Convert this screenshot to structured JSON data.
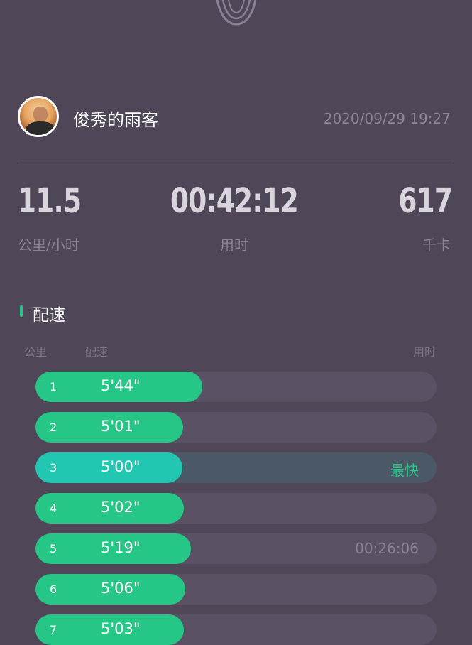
{
  "colors": {
    "background": "#4f4657",
    "accent_green": "#25c686",
    "accent_teal": "#22c7b1",
    "track": "#5a5164",
    "muted_text": "#8b8393"
  },
  "profile": {
    "username": "俊秀的雨客",
    "timestamp": "2020/09/29 19:27",
    "avatar_icon": "avatar-photo"
  },
  "stats": [
    {
      "value": "11.5",
      "label": "公里/小时"
    },
    {
      "value": "00:42:12",
      "label": "用时"
    },
    {
      "value": "617",
      "label": "千卡"
    }
  ],
  "pace_section": {
    "title": "配速",
    "headers": {
      "km": "公里",
      "pace": "配速",
      "time": "用时"
    },
    "rows": [
      {
        "km": "1",
        "pace": "5'44\"",
        "fill": 0.416,
        "best": false,
        "tag": ""
      },
      {
        "km": "2",
        "pace": "5'01\"",
        "fill": 0.368,
        "best": false,
        "tag": ""
      },
      {
        "km": "3",
        "pace": "5'00\"",
        "fill": 0.366,
        "best": true,
        "tag": "最快"
      },
      {
        "km": "4",
        "pace": "5'02\"",
        "fill": 0.37,
        "best": false,
        "tag": ""
      },
      {
        "km": "5",
        "pace": "5'19\"",
        "fill": 0.388,
        "best": false,
        "tag": "00:26:06"
      },
      {
        "km": "6",
        "pace": "5'06\"",
        "fill": 0.373,
        "best": false,
        "tag": ""
      },
      {
        "km": "7",
        "pace": "5'03\"",
        "fill": 0.37,
        "best": false,
        "tag": ""
      }
    ]
  }
}
